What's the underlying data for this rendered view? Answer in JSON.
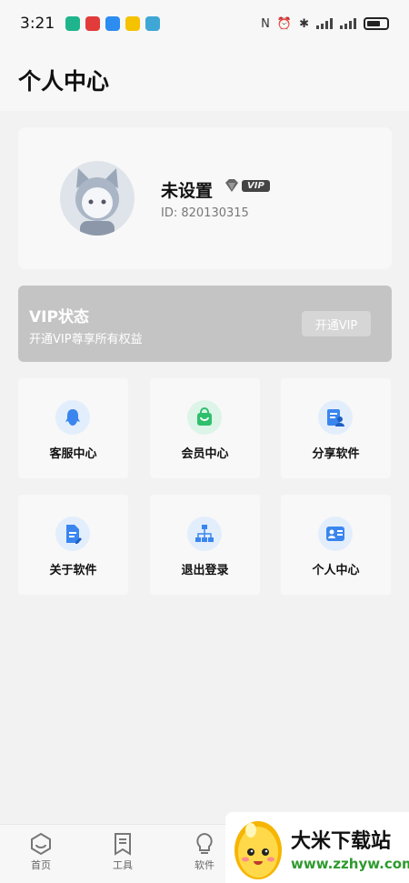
{
  "status_bar": {
    "time": "3:21",
    "battery": "battery-icon",
    "notif_colors": [
      "#1fb58c",
      "#e23b3b",
      "#2d8cf0",
      "#f5c200",
      "#3fa7d6"
    ]
  },
  "header": {
    "title": "个人中心"
  },
  "profile": {
    "username": "未设置",
    "vip_badge": "VIP",
    "user_id": "ID: 820130315"
  },
  "vip_card": {
    "title": "VIP状态",
    "subtitle": "开通VIP尊享所有权益",
    "button": "开通VIP",
    "bg_color": "#c4c4c4"
  },
  "grid": [
    {
      "label": "客服中心",
      "icon": "customer-service-icon"
    },
    {
      "label": "会员中心",
      "icon": "shopping-bag-icon"
    },
    {
      "label": "分享软件",
      "icon": "share-icon"
    },
    {
      "label": "关于软件",
      "icon": "document-icon"
    },
    {
      "label": "退出登录",
      "icon": "sitemap-icon"
    },
    {
      "label": "个人中心",
      "icon": "id-card-icon"
    }
  ],
  "bottom_nav": [
    {
      "label": "首页",
      "icon": "home-icon"
    },
    {
      "label": "工具",
      "icon": "bookmark-icon"
    },
    {
      "label": "软件",
      "icon": "bulb-icon"
    }
  ],
  "watermark": {
    "title": "大米下载站",
    "url": "www.zzhyw.com"
  }
}
